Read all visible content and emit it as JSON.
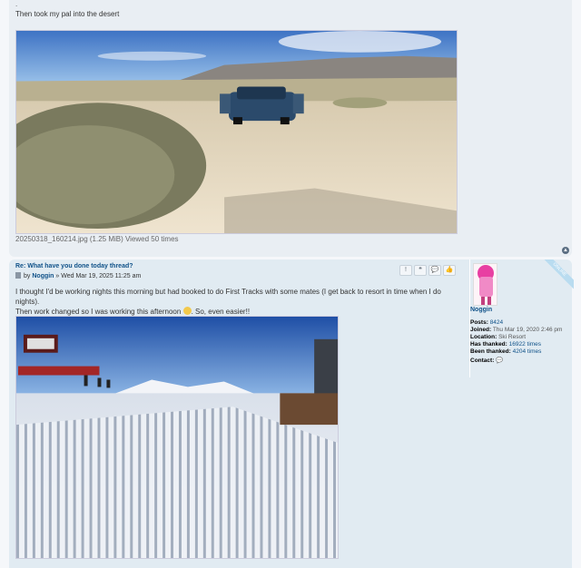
{
  "post1": {
    "dot": ".",
    "text": "Then took my pal into the desert",
    "attachment_caption": "20250318_160214.jpg (1.25 MiB) Viewed 50 times"
  },
  "post2": {
    "title": "Re: What have you done today thread?",
    "by_label": "by",
    "author": "Noggin",
    "date": "» Wed Mar 19, 2025 11:25 am",
    "body_line1": "I thought I'd be working nights this morning but had booked to do First Tracks with some mates (I get back to resort in time when I do nights).",
    "body_line2a": "Then work changed so I was working this afternoon",
    "body_line2b": ". So, even easier!!",
    "actions": [
      "!",
      "❝",
      "💬",
      "👍"
    ]
  },
  "profile": {
    "badge": "ONLINE",
    "username": "Noggin",
    "posts_label": "Posts:",
    "posts": "8424",
    "joined_label": "Joined:",
    "joined": "Thu Mar 19, 2020 2:46 pm",
    "location_label": "Location:",
    "location": "Ski Resort",
    "has_thanked_label": "Has thanked:",
    "has_thanked": "16922 times",
    "been_thanked_label": "Been thanked:",
    "been_thanked": "4204 times",
    "contact_label": "Contact:"
  }
}
